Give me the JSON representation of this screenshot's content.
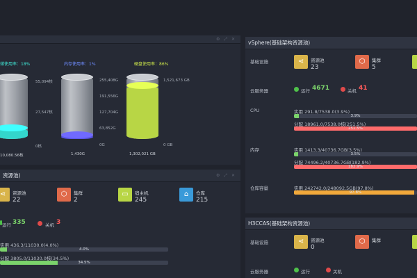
{
  "storage": {
    "gauges": [
      {
        "title": "储使用率：18%",
        "title_color": "#3fe0d0",
        "ticks": [
          "55,094核",
          "27,547核",
          "0核"
        ],
        "total": "10,080.56核",
        "fill_pct": 18,
        "fill_color": "#33d6cc"
      },
      {
        "title": "内存使用率：1%",
        "title_color": "#6f8cff",
        "ticks": [
          "255,408G",
          "191,556G",
          "127,704G",
          "63,852G",
          "0G"
        ],
        "total": "1,430G",
        "fill_pct": 1,
        "fill_color": "#5a55e8"
      },
      {
        "title": "硬盘使用率：86%",
        "title_color": "#c9e24a",
        "ticks": [
          "1,521,673 GB",
          "0 GB"
        ],
        "total": "1,302,021 GB",
        "fill_pct": 86,
        "fill_color": "#b8d645"
      }
    ]
  },
  "left_pool": {
    "title": "资源池)",
    "tiles": [
      {
        "name": "资源池",
        "value": "22",
        "icon": "share-icon",
        "color": "#d9b44a"
      },
      {
        "name": "集群",
        "value": "2",
        "icon": "cube-icon",
        "color": "#e06a4a"
      },
      {
        "name": "宿主机",
        "value": "245",
        "icon": "server-icon",
        "color": "#b8d645"
      },
      {
        "name": "仓库",
        "value": "215",
        "icon": "warehouse-icon",
        "color": "#3a9ad9"
      }
    ],
    "running_label": "运行",
    "running_value": "335",
    "off_label": "关机",
    "off_value": "3",
    "cpu_used": "实用 436.3/11030.0(4.0%)",
    "cpu_used_pct": 4.0,
    "cpu_used_pct_label": "4.0%",
    "cpu_alloc": "分配 3805.0/11030.0核(34.5%)",
    "cpu_alloc_pct": 34.5,
    "cpu_alloc_pct_label": "34.5%"
  },
  "vsphere": {
    "title": "vSphere(基础架构资源池)",
    "infra_label": "基础设施",
    "tiles": [
      {
        "name": "资源池",
        "value": "23",
        "icon": "share-icon",
        "color": "#d9b44a"
      },
      {
        "name": "集群",
        "value": "5",
        "icon": "cube-icon",
        "color": "#e06a4a"
      }
    ],
    "cloud_label": "云服务器",
    "running_label": "运行",
    "running_value": "4671",
    "off_label": "关机",
    "off_value": "41",
    "cpu_label": "CPU",
    "cpu_used": "实用 291.8/7538.0(3.9%)",
    "cpu_used_pct": 3.9,
    "cpu_used_pct_label": "3.9%",
    "cpu_alloc": "分配 18961.0/7538.0核(251.5%)",
    "cpu_alloc_pct": 100,
    "cpu_alloc_pct_label": "251.5%",
    "mem_label": "内存",
    "mem_used": "实用 1413.3/40736.7GB(3.5%)",
    "mem_used_pct": 3.5,
    "mem_used_pct_label": "3.5%",
    "mem_alloc": "分配 74496.2/40736.7GB(182.9%)",
    "mem_alloc_pct": 100,
    "mem_alloc_pct_label": "182.9%",
    "store_label": "仓库容量",
    "store_used": "实用 242742.0/248092.5GB(97.8%)",
    "store_used_pct": 97.8,
    "store_used_pct_label": "97.8%"
  },
  "h3c": {
    "title": "H3CCAS(基础架构资源池)",
    "infra_label": "基础设施",
    "tiles": [
      {
        "name": "资源池",
        "value": "0",
        "icon": "share-icon",
        "color": "#d9b44a"
      },
      {
        "name": "集群",
        "value": "",
        "icon": "cube-icon",
        "color": "#e06a4a"
      }
    ],
    "cloud_label": "云服务器",
    "running_label": "运行",
    "off_label": "关机"
  },
  "colors": {
    "green": "#7bd36b",
    "red": "#ff5a5a",
    "alloc_red": "#ff6b6b",
    "used_green": "#7bd36b",
    "store_orange": "#f2a93b"
  }
}
